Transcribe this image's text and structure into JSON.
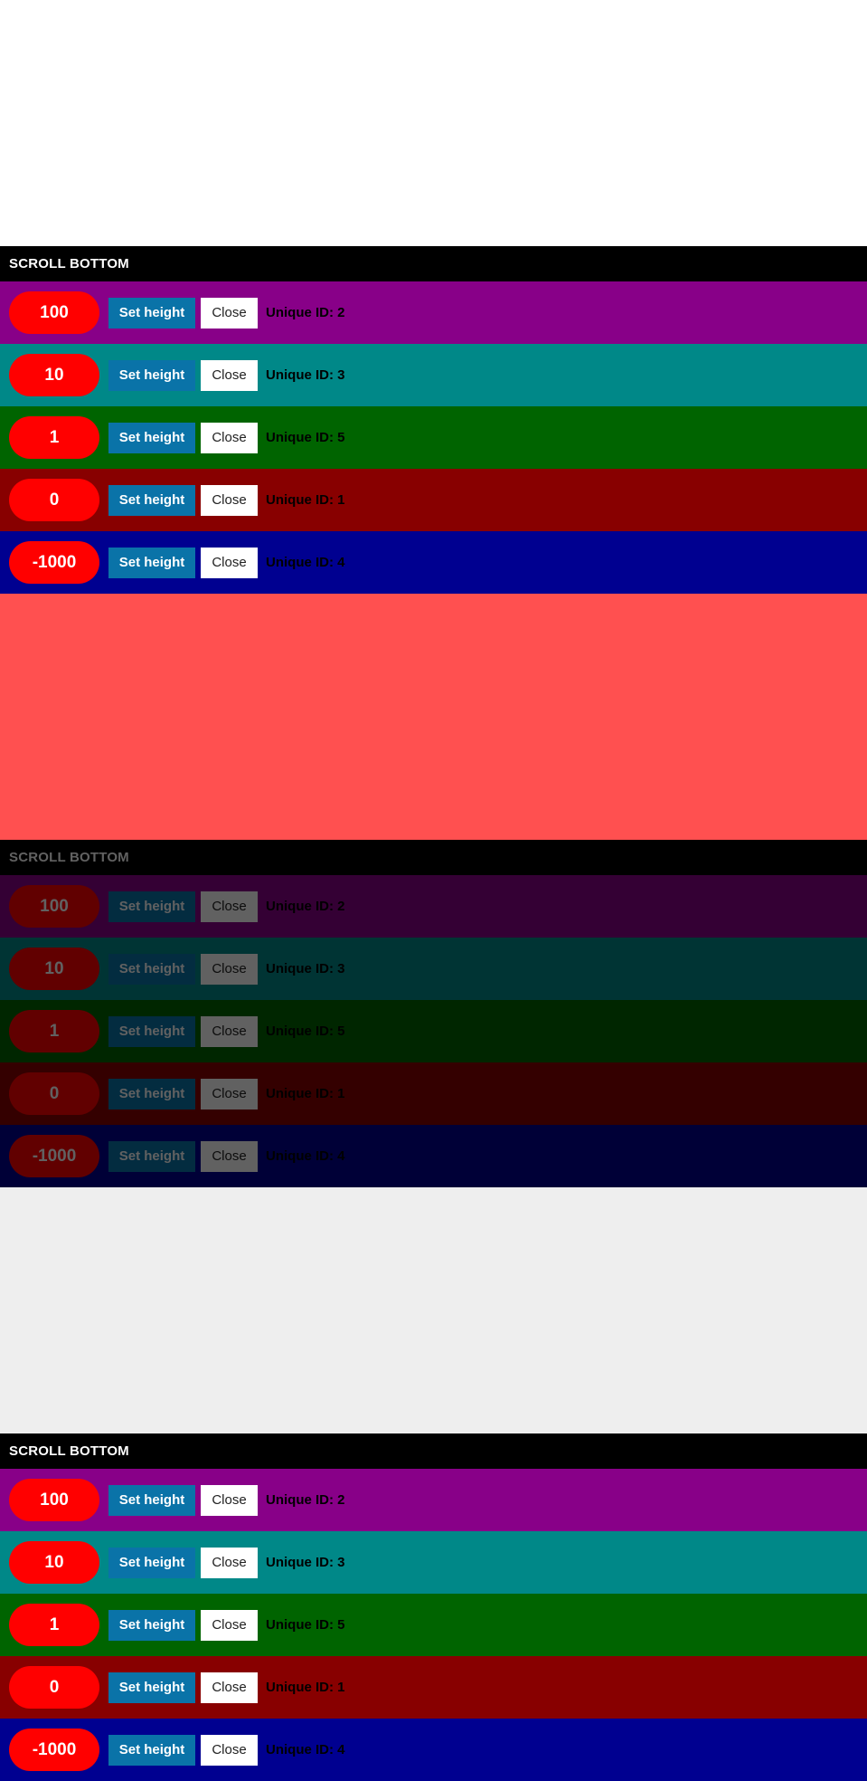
{
  "colors": {
    "top_region": "#ffffff",
    "middle_region": "#ff5050",
    "lower_region": "#eeeeee",
    "header": "#000000",
    "pill": "#ff0000",
    "set_height_button": "#0a73a8",
    "close_button": "#ffffff"
  },
  "panel": {
    "header_label": "SCROLL BOTTOM",
    "set_height_label": "Set height",
    "close_label": "Close",
    "rows": [
      {
        "value": "100",
        "uid_label": "Unique ID: 2",
        "color": "#880088"
      },
      {
        "value": "10",
        "uid_label": "Unique ID: 3",
        "color": "#008888"
      },
      {
        "value": "1",
        "uid_label": "Unique ID: 5",
        "color": "#006400"
      },
      {
        "value": "0",
        "uid_label": "Unique ID: 1",
        "color": "#880000"
      },
      {
        "value": "-1000",
        "uid_label": "Unique ID: 4",
        "color": "#000090"
      }
    ]
  }
}
